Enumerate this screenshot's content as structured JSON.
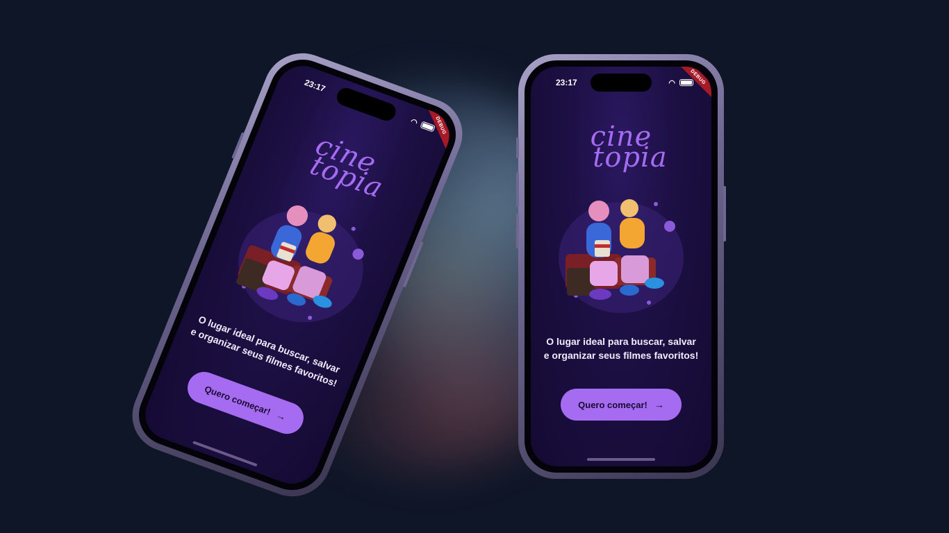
{
  "phones": [
    {
      "id": "left",
      "status_time": "23:17",
      "debug_label": "DEBUG",
      "logo_line1": "cine",
      "logo_line2": "topia",
      "tagline": "O lugar ideal para buscar, salvar e organizar seus filmes favoritos!",
      "cta_label": "Quero começar!",
      "cta_icon": "arrow-right-icon"
    },
    {
      "id": "right",
      "status_time": "23:17",
      "debug_label": "DEBUG",
      "logo_line1": "cine",
      "logo_line2": "topia",
      "tagline": "O lugar ideal para buscar, salvar e organizar seus filmes favoritos!",
      "cta_label": "Quero começar!",
      "cta_icon": "arrow-right-icon"
    }
  ],
  "colors": {
    "background": "#0f1628",
    "accent": "#a56bf0",
    "screen_top": "#2a1860",
    "screen_bottom": "#150a33",
    "debug_banner": "#a51a26"
  }
}
